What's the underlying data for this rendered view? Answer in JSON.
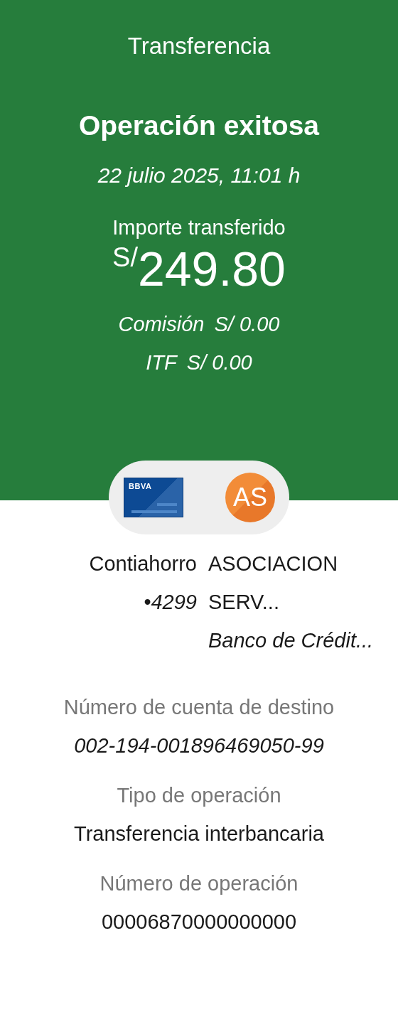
{
  "header": {
    "title": "Transferencia",
    "status": "Operación exitosa",
    "datetime": "22 julio 2025, 11:01 h",
    "amount_label": "Importe transferido",
    "currency": "S/",
    "amount": "249.80",
    "fees": [
      {
        "label": "Comisión",
        "value": "S/ 0.00"
      },
      {
        "label": "ITF",
        "value": "S/ 0.00"
      }
    ]
  },
  "parties": {
    "source_card_logo": "BBVA",
    "destination_initials": "AS"
  },
  "source": {
    "account_type": "Contiahorro",
    "account_number": "•4299"
  },
  "destination": {
    "name_lines": [
      "ASOCIACION",
      "SERV..."
    ],
    "bank": "Banco de Crédit..."
  },
  "details": [
    {
      "label": "Número de cuenta de destino",
      "value": "002-194-001896469050-99",
      "italic": true
    },
    {
      "label": "Tipo de operación",
      "value": "Transferencia interbancaria",
      "italic": false
    },
    {
      "label": "Número de operación",
      "value": "00006870000000000",
      "italic": false
    }
  ]
}
